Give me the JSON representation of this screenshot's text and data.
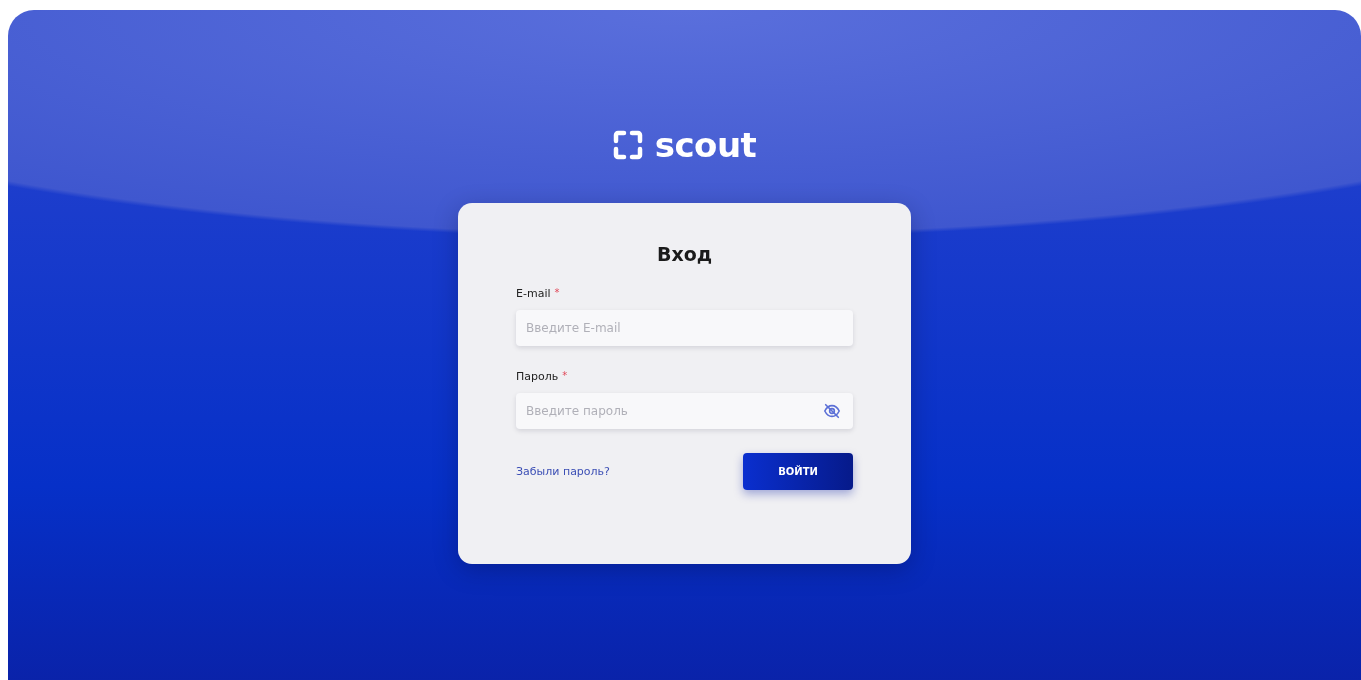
{
  "logo": {
    "text": "scout"
  },
  "login_card": {
    "title": "Вход",
    "fields": [
      {
        "kind": "text",
        "label": "E-mail",
        "required_mark": "*",
        "placeholder": "Введите E-mail"
      },
      {
        "kind": "password",
        "label": "Пароль",
        "required_mark": "*",
        "placeholder": "Введите пароль"
      }
    ],
    "forgot_link": "Забыли пароль?",
    "submit_button": "ВОЙТИ"
  }
}
